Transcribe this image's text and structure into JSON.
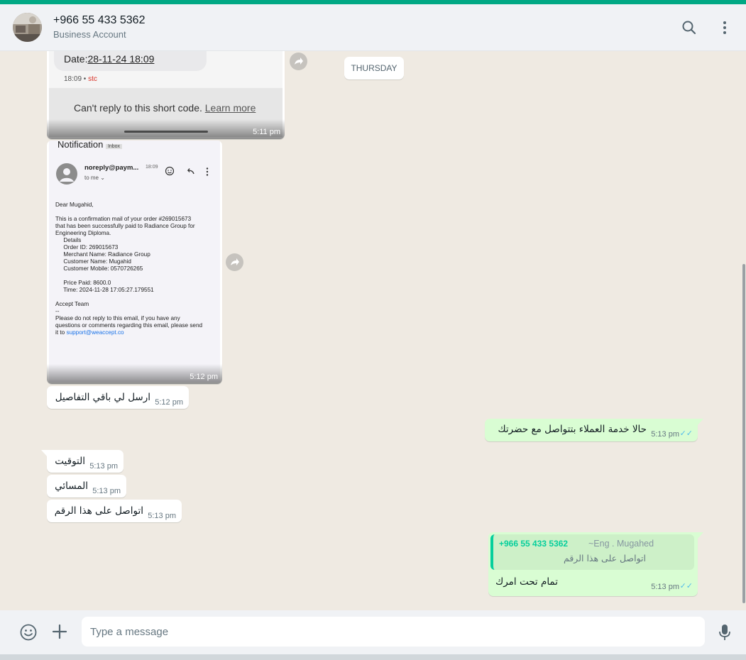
{
  "header": {
    "contact_name": "+966 55 433 5362",
    "subtitle": "Business Account",
    "icons": [
      "search-icon",
      "menu-icon"
    ]
  },
  "date_divider": "THURSDAY",
  "sms_image": {
    "date_label": "Date:",
    "date_value": "28-11-24 18:09",
    "meta_time": "18:09",
    "meta_sep": " • ",
    "meta_carrier": "stc",
    "cant_reply": "Can't reply to this short code. ",
    "learn_more": "Learn more",
    "time": "5:11 pm"
  },
  "email_image": {
    "heading": "Notification",
    "inbox_tag": "Inbox",
    "sender": "noreply@paym...",
    "sender_time": "18:09",
    "to_me": "to me ⌄",
    "lines": [
      "Dear Mugahid,",
      " This is a confirmation mail of your order #269015673",
      "that has been successfully paid to  Radiance Group for",
      "Engineering Diploma.",
      "     Details",
      "     Order ID: 269015673",
      "     Merchant Name: Radiance Group",
      "     Customer Name: Mugahid",
      "     Customer Mobile: 0570726265",
      "     Price Paid: 8600.0",
      "     Time: 2024-11-28 17:05:27.179551",
      "Accept Team",
      "--",
      "Please do not reply to this email, if you have any",
      "questions or comments regarding this email, please send",
      "it to "
    ],
    "support_link": "support@weaccept.co",
    "time": "5:12 pm"
  },
  "messages": [
    {
      "text": "ارسل لي باقي التفاصيل",
      "time": "5:12 pm",
      "direction": "in"
    },
    {
      "text": "حالا خدمة العملاء بتتواصل مع حضرتك",
      "time": "5:13 pm",
      "direction": "out"
    },
    {
      "text": "التوقيت",
      "time": "5:13 pm",
      "direction": "in"
    },
    {
      "text": "المسائي",
      "time": "5:13 pm",
      "direction": "in"
    },
    {
      "text": "اتواصل على هذا الرقم",
      "time": "5:13 pm",
      "direction": "in"
    },
    {
      "text": "تمام تحت امرك",
      "time": "5:13 pm",
      "direction": "out"
    }
  ],
  "reply_quote": {
    "author_number": "+966 55 433 5362",
    "author_name": "~Eng . Mugahed",
    "quoted_text": "اتواصل على هذا الرقم"
  },
  "composer": {
    "placeholder": "Type a message",
    "icons": [
      "emoji-icon",
      "plus-icon",
      "mic-icon"
    ]
  },
  "colors": {
    "accent": "#00a884",
    "outgoing_bubble": "#d9fdd3",
    "incoming_bubble": "#ffffff",
    "read_ticks": "#53bdeb",
    "chat_background": "#efeae2"
  }
}
